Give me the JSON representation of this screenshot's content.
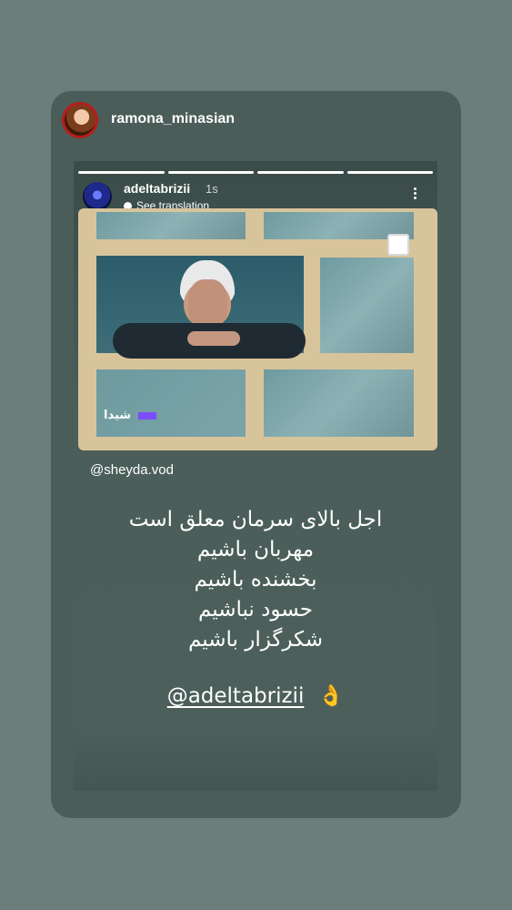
{
  "outer": {
    "username": "ramona_minasian"
  },
  "story": {
    "username": "adeltabrizii",
    "time": "1s",
    "see_translation": "See translation",
    "photo_mention": "@sheyda.vod",
    "logo_text": "شیدا",
    "poem_lines": [
      "اجل بالای سرمان معلق است",
      "مهربان باشیم",
      "بخشنده باشیم",
      "حسود نباشیم",
      "شکرگزار باشیم"
    ],
    "mention_tag": "@adeltabrizii",
    "emoji": "👌",
    "progress": {
      "segments": 4,
      "completed": 4
    }
  },
  "icons": [
    "more-options-icon",
    "translate-icon",
    "ok-hand-icon"
  ]
}
